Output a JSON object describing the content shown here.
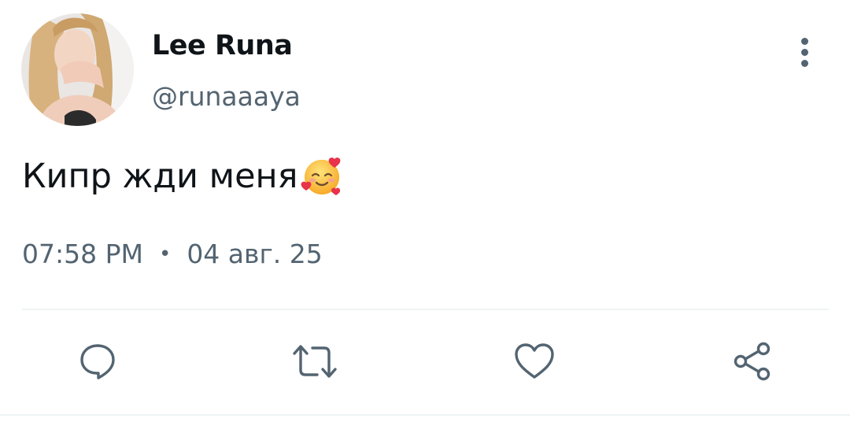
{
  "tweet": {
    "author": {
      "display_name": "Lee Runa",
      "handle": "@runaaaya"
    },
    "text": "Кипр жди меня",
    "emoji": "smiling-face-with-hearts",
    "time": "07:58 PM",
    "separator": "•",
    "date": "04 авг. 25"
  },
  "actions": [
    {
      "icon": "reply-icon"
    },
    {
      "icon": "retweet-icon"
    },
    {
      "icon": "like-icon"
    },
    {
      "icon": "share-icon"
    }
  ],
  "colors": {
    "text_primary": "#0f1419",
    "text_secondary": "#536471",
    "divider": "#eff3f4"
  }
}
